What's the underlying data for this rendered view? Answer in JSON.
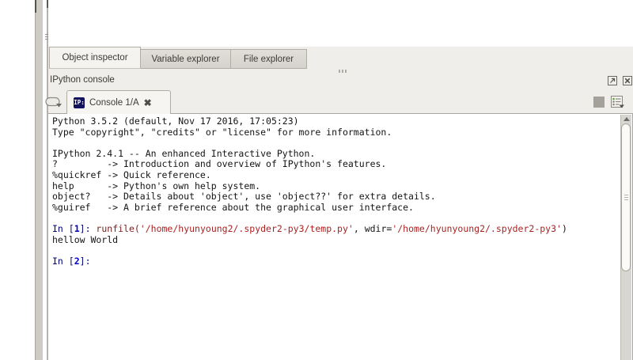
{
  "upper_pane": {
    "tabs": [
      {
        "label": "Object inspector",
        "active": true
      },
      {
        "label": "Variable explorer",
        "active": false
      },
      {
        "label": "File explorer",
        "active": false
      }
    ]
  },
  "console_pane": {
    "title": "IPython console",
    "tab": {
      "icon_text": "IP:",
      "label": "Console 1/A",
      "close_glyph": "✖"
    }
  },
  "console": {
    "syntax_colors": {
      "text": "#141414",
      "prompt": "#00007f",
      "number": "#0000c8",
      "func": "#7a1f1f",
      "string": "#aa2222"
    },
    "lines": [
      [
        {
          "t": "Python 3.5.2 (default, Nov 17 2016, 17:05:23)",
          "c": "k"
        }
      ],
      [
        {
          "t": "Type \"copyright\", \"credits\" or \"license\" for more information.",
          "c": "k"
        }
      ],
      [],
      [
        {
          "t": "IPython 2.4.1 -- An enhanced Interactive Python.",
          "c": "k"
        }
      ],
      [
        {
          "t": "?         -> Introduction and overview of IPython's features.",
          "c": "k"
        }
      ],
      [
        {
          "t": "%quickref -> Quick reference.",
          "c": "k"
        }
      ],
      [
        {
          "t": "help      -> Python's own help system.",
          "c": "k"
        }
      ],
      [
        {
          "t": "object?   -> Details about 'object', use 'object??' for extra details.",
          "c": "k"
        }
      ],
      [
        {
          "t": "%guiref   -> A brief reference about the graphical user interface.",
          "c": "k"
        }
      ],
      [],
      [
        {
          "t": "In [",
          "c": "p"
        },
        {
          "t": "1",
          "c": "n"
        },
        {
          "t": "]: ",
          "c": "p"
        },
        {
          "t": "runfile(",
          "c": "f"
        },
        {
          "t": "'/home/hyunyoung2/.spyder2-py3/temp.py'",
          "c": "s"
        },
        {
          "t": ", wdir=",
          "c": "k"
        },
        {
          "t": "'/home/hyunyoung2/.spyder2-py3'",
          "c": "s"
        },
        {
          "t": ")",
          "c": "k"
        }
      ],
      [
        {
          "t": "hellow World",
          "c": "k"
        }
      ],
      [],
      [
        {
          "t": "In [",
          "c": "p"
        },
        {
          "t": "2",
          "c": "n"
        },
        {
          "t": "]:",
          "c": "p"
        }
      ]
    ]
  }
}
